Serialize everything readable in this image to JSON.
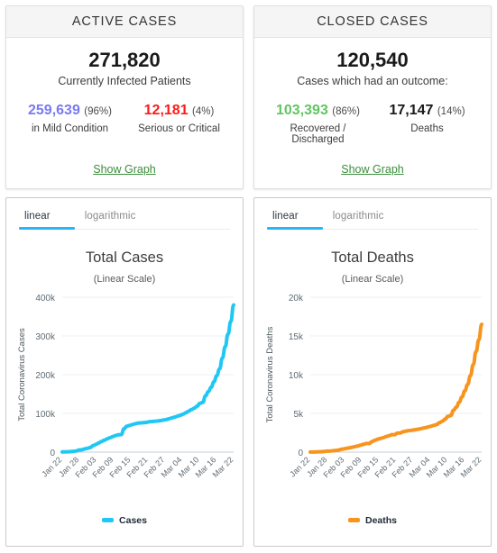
{
  "cards": [
    {
      "title": "ACTIVE CASES",
      "total": "271,820",
      "caption": "Currently Infected Patients",
      "left": {
        "value": "259,639",
        "pct": "(96%)",
        "label": "in Mild Condition",
        "color": "#7a7af0"
      },
      "right": {
        "value": "12,181",
        "pct": "(4%)",
        "label": "Serious or Critical",
        "color": "#ff1a1a"
      },
      "link": "Show Graph"
    },
    {
      "title": "CLOSED CASES",
      "total": "120,540",
      "caption": "Cases which had an outcome:",
      "left": {
        "value": "103,393",
        "pct": "(86%)",
        "label": "Recovered / Discharged",
        "color": "#62c462"
      },
      "right": {
        "value": "17,147",
        "pct": "(14%)",
        "label": "Deaths",
        "color": "#1a1a1a"
      },
      "link": "Show Graph"
    }
  ],
  "charts": [
    {
      "tabs": {
        "linear": "linear",
        "logarithmic": "logarithmic",
        "active": "linear"
      },
      "title": "Total Cases",
      "subtitle": "(Linear Scale)",
      "legend": {
        "label": "Cases",
        "color": "#21c7f4"
      }
    },
    {
      "tabs": {
        "linear": "linear",
        "logarithmic": "logarithmic",
        "active": "linear"
      },
      "title": "Total Deaths",
      "subtitle": "(Linear Scale)",
      "legend": {
        "label": "Deaths",
        "color": "#f7941e"
      }
    }
  ],
  "chart_data": [
    {
      "type": "line",
      "title": "Total Cases",
      "subtitle": "(Linear Scale)",
      "xlabel": "",
      "ylabel": "Total Coronavirus Cases",
      "ylim": [
        0,
        400000
      ],
      "yticks": [
        0,
        100000,
        200000,
        300000,
        400000
      ],
      "ytick_labels": [
        "0",
        "100k",
        "200k",
        "300k",
        "400k"
      ],
      "grid": true,
      "legend_position": "bottom",
      "line_color": "#21c7f4",
      "series": [
        {
          "name": "Cases",
          "x": [
            "Jan 22",
            "Jan 23",
            "Jan 24",
            "Jan 25",
            "Jan 26",
            "Jan 27",
            "Jan 28",
            "Jan 29",
            "Jan 30",
            "Jan 31",
            "Feb 01",
            "Feb 02",
            "Feb 03",
            "Feb 04",
            "Feb 05",
            "Feb 06",
            "Feb 07",
            "Feb 08",
            "Feb 09",
            "Feb 10",
            "Feb 11",
            "Feb 12",
            "Feb 13",
            "Feb 14",
            "Feb 15",
            "Feb 16",
            "Feb 17",
            "Feb 18",
            "Feb 19",
            "Feb 20",
            "Feb 21",
            "Feb 22",
            "Feb 23",
            "Feb 24",
            "Feb 25",
            "Feb 26",
            "Feb 27",
            "Feb 28",
            "Feb 29",
            "Mar 01",
            "Mar 02",
            "Mar 03",
            "Mar 04",
            "Mar 05",
            "Mar 06",
            "Mar 07",
            "Mar 08",
            "Mar 09",
            "Mar 10",
            "Mar 11",
            "Mar 12",
            "Mar 13",
            "Mar 14",
            "Mar 15",
            "Mar 16",
            "Mar 17",
            "Mar 18",
            "Mar 19",
            "Mar 20",
            "Mar 21",
            "Mar 22"
          ],
          "values": [
            555,
            654,
            941,
            1434,
            2118,
            2927,
            5578,
            6166,
            8234,
            9927,
            12038,
            16787,
            19881,
            23892,
            27635,
            30794,
            34391,
            37120,
            40150,
            42762,
            44802,
            45221,
            60368,
            66885,
            69030,
            71224,
            73258,
            75136,
            75639,
            76197,
            76819,
            78572,
            78985,
            79570,
            80415,
            81397,
            82756,
            84124,
            86013,
            88371,
            90307,
            92844,
            95124,
            97886,
            101801,
            105836,
            109826,
            113584,
            118613,
            125875,
            128352,
            145205,
            156097,
            167454,
            181574,
            197168,
            214910,
            242713,
            272167,
            304528,
            337459
          ],
          "last_value_approx": 380000
        }
      ],
      "xtick_labels": [
        "Jan 22",
        "Jan 28",
        "Feb 03",
        "Feb 09",
        "Feb 15",
        "Feb 21",
        "Feb 27",
        "Mar 04",
        "Mar 10",
        "Mar 16",
        "Mar 22"
      ]
    },
    {
      "type": "line",
      "title": "Total Deaths",
      "subtitle": "(Linear Scale)",
      "xlabel": "",
      "ylabel": "Total Coronavirus Deaths",
      "ylim": [
        0,
        20000
      ],
      "yticks": [
        0,
        5000,
        10000,
        15000,
        20000
      ],
      "ytick_labels": [
        "0",
        "5k",
        "10k",
        "15k",
        "20k"
      ],
      "grid": true,
      "legend_position": "bottom",
      "line_color": "#f7941e",
      "series": [
        {
          "name": "Deaths",
          "x": [
            "Jan 22",
            "Jan 23",
            "Jan 24",
            "Jan 25",
            "Jan 26",
            "Jan 27",
            "Jan 28",
            "Jan 29",
            "Jan 30",
            "Jan 31",
            "Feb 01",
            "Feb 02",
            "Feb 03",
            "Feb 04",
            "Feb 05",
            "Feb 06",
            "Feb 07",
            "Feb 08",
            "Feb 09",
            "Feb 10",
            "Feb 11",
            "Feb 12",
            "Feb 13",
            "Feb 14",
            "Feb 15",
            "Feb 16",
            "Feb 17",
            "Feb 18",
            "Feb 19",
            "Feb 20",
            "Feb 21",
            "Feb 22",
            "Feb 23",
            "Feb 24",
            "Feb 25",
            "Feb 26",
            "Feb 27",
            "Feb 28",
            "Feb 29",
            "Mar 01",
            "Mar 02",
            "Mar 03",
            "Mar 04",
            "Mar 05",
            "Mar 06",
            "Mar 07",
            "Mar 08",
            "Mar 09",
            "Mar 10",
            "Mar 11",
            "Mar 12",
            "Mar 13",
            "Mar 14",
            "Mar 15",
            "Mar 16",
            "Mar 17",
            "Mar 18",
            "Mar 19",
            "Mar 20",
            "Mar 21",
            "Mar 22"
          ],
          "values": [
            17,
            18,
            26,
            42,
            56,
            82,
            131,
            133,
            171,
            213,
            259,
            362,
            426,
            492,
            564,
            634,
            719,
            806,
            906,
            1013,
            1113,
            1118,
            1371,
            1523,
            1666,
            1770,
            1868,
            2007,
            2122,
            2247,
            2251,
            2458,
            2469,
            2629,
            2708,
            2770,
            2814,
            2872,
            2941,
            2996,
            3085,
            3160,
            3254,
            3348,
            3460,
            3558,
            3802,
            3988,
            4262,
            4615,
            4720,
            5404,
            5819,
            6440,
            7126,
            7905,
            8733,
            9867,
            11299,
            12973,
            14510
          ],
          "last_value_approx": 16500
        }
      ],
      "xtick_labels": [
        "Jan 22",
        "Jan 28",
        "Feb 03",
        "Feb 09",
        "Feb 15",
        "Feb 21",
        "Feb 27",
        "Mar 04",
        "Mar 10",
        "Mar 16",
        "Mar 22"
      ]
    }
  ]
}
